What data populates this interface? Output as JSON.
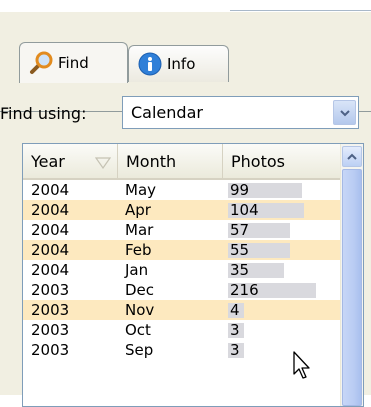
{
  "tabs": [
    {
      "label": "Find",
      "icon": "search-icon"
    },
    {
      "label": "Info",
      "icon": "info-icon"
    }
  ],
  "find_using": {
    "label": "Find using:",
    "value": "Calendar"
  },
  "table": {
    "headers": {
      "year": "Year",
      "month": "Month",
      "photos": "Photos"
    },
    "rows": [
      {
        "year": "2004",
        "month": "May",
        "photos": "99"
      },
      {
        "year": "2004",
        "month": "Apr",
        "photos": "104"
      },
      {
        "year": "2004",
        "month": "Mar",
        "photos": "57"
      },
      {
        "year": "2004",
        "month": "Feb",
        "photos": "55"
      },
      {
        "year": "2004",
        "month": "Jan",
        "photos": "35"
      },
      {
        "year": "2003",
        "month": "Dec",
        "photos": "216"
      },
      {
        "year": "2003",
        "month": "Nov",
        "photos": "4"
      },
      {
        "year": "2003",
        "month": "Oct",
        "photos": "3"
      },
      {
        "year": "2003",
        "month": "Sep",
        "photos": "3"
      }
    ]
  },
  "colors": {
    "highlight_row": "#fde9bf",
    "bar": "#d9d9de",
    "panel": "#f1efe2",
    "border": "#7f9db9"
  }
}
